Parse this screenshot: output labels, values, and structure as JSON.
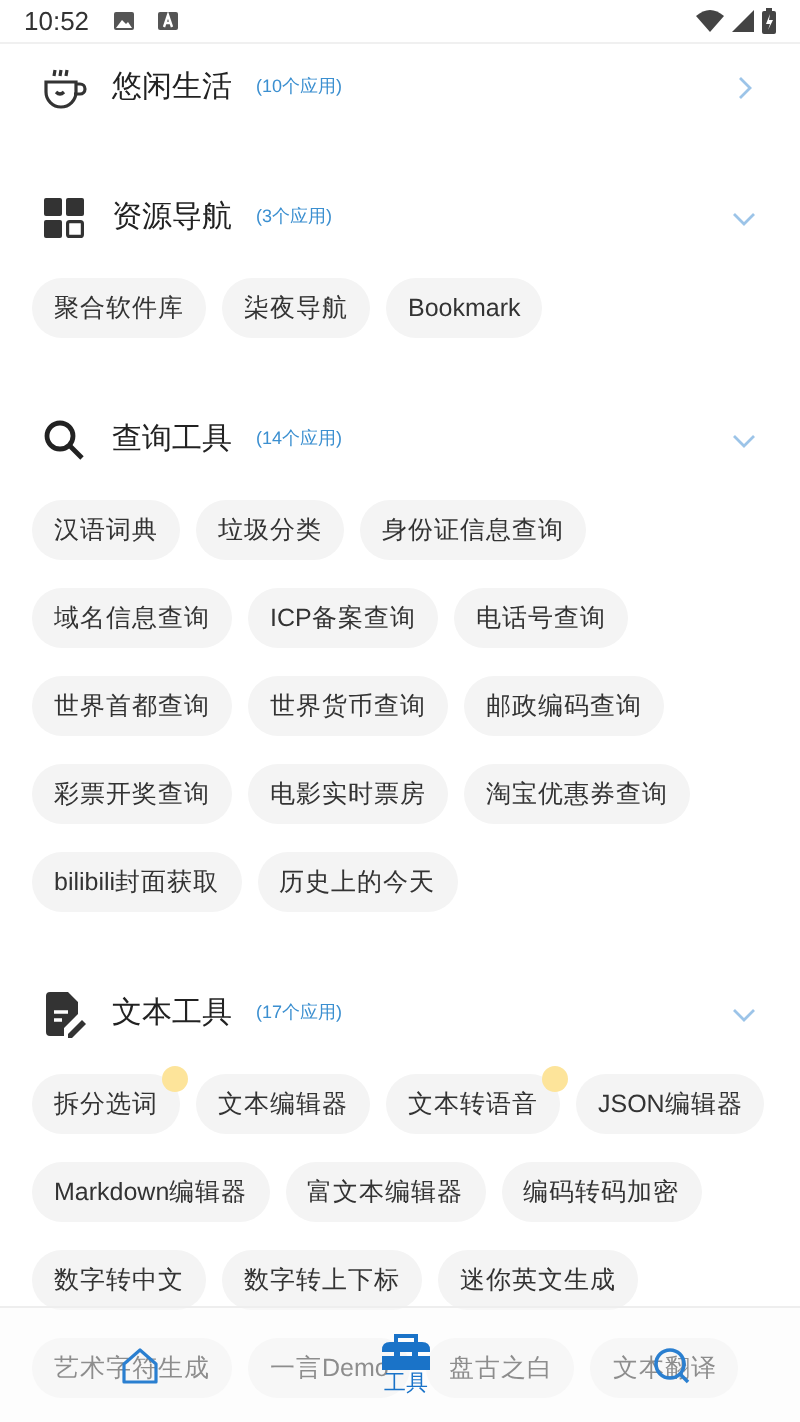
{
  "status_bar": {
    "time": "10:52"
  },
  "sections": [
    {
      "kind": "cup",
      "title": "悠闲生活",
      "count": "(10个应用)",
      "expanded": false
    },
    {
      "kind": "grid",
      "title": "资源导航",
      "count": "(3个应用)",
      "expanded": true,
      "apps": [
        {
          "label": "聚合软件库",
          "new": false
        },
        {
          "label": "柒夜导航",
          "new": false
        },
        {
          "label": "Bookmark",
          "new": false
        }
      ]
    },
    {
      "kind": "search",
      "title": "查询工具",
      "count": "(14个应用)",
      "expanded": true,
      "apps": [
        {
          "label": "汉语词典",
          "new": false
        },
        {
          "label": "垃圾分类",
          "new": false
        },
        {
          "label": "身份证信息查询",
          "new": false
        },
        {
          "label": "域名信息查询",
          "new": false
        },
        {
          "label": "ICP备案查询",
          "new": false
        },
        {
          "label": "电话号查询",
          "new": false
        },
        {
          "label": "世界首都查询",
          "new": false
        },
        {
          "label": "世界货币查询",
          "new": false
        },
        {
          "label": "邮政编码查询",
          "new": false
        },
        {
          "label": "彩票开奖查询",
          "new": false
        },
        {
          "label": "电影实时票房",
          "new": false
        },
        {
          "label": "淘宝优惠券查询",
          "new": false
        },
        {
          "label": "bilibili封面获取",
          "new": false
        },
        {
          "label": "历史上的今天",
          "new": false
        }
      ]
    },
    {
      "kind": "doc",
      "title": "文本工具",
      "count": "(17个应用)",
      "expanded": true,
      "apps": [
        {
          "label": "拆分选词",
          "new": true
        },
        {
          "label": "文本编辑器",
          "new": false
        },
        {
          "label": "文本转语音",
          "new": true
        },
        {
          "label": "JSON编辑器",
          "new": false
        },
        {
          "label": "Markdown编辑器",
          "new": false
        },
        {
          "label": "富文本编辑器",
          "new": false
        },
        {
          "label": "编码转码加密",
          "new": false
        },
        {
          "label": "数字转中文",
          "new": false
        },
        {
          "label": "数字转上下标",
          "new": false
        },
        {
          "label": "迷你英文生成",
          "new": false
        },
        {
          "label": "艺术字符生成",
          "new": false
        },
        {
          "label": "一言Demo",
          "new": false
        },
        {
          "label": "盘古之白",
          "new": false
        },
        {
          "label": "文本翻译",
          "new": false
        }
      ]
    }
  ],
  "bottom_nav": [
    {
      "kind": "home",
      "selected": false
    },
    {
      "kind": "toolbox",
      "label": "工具",
      "selected": true
    },
    {
      "kind": "search",
      "selected": false
    }
  ]
}
